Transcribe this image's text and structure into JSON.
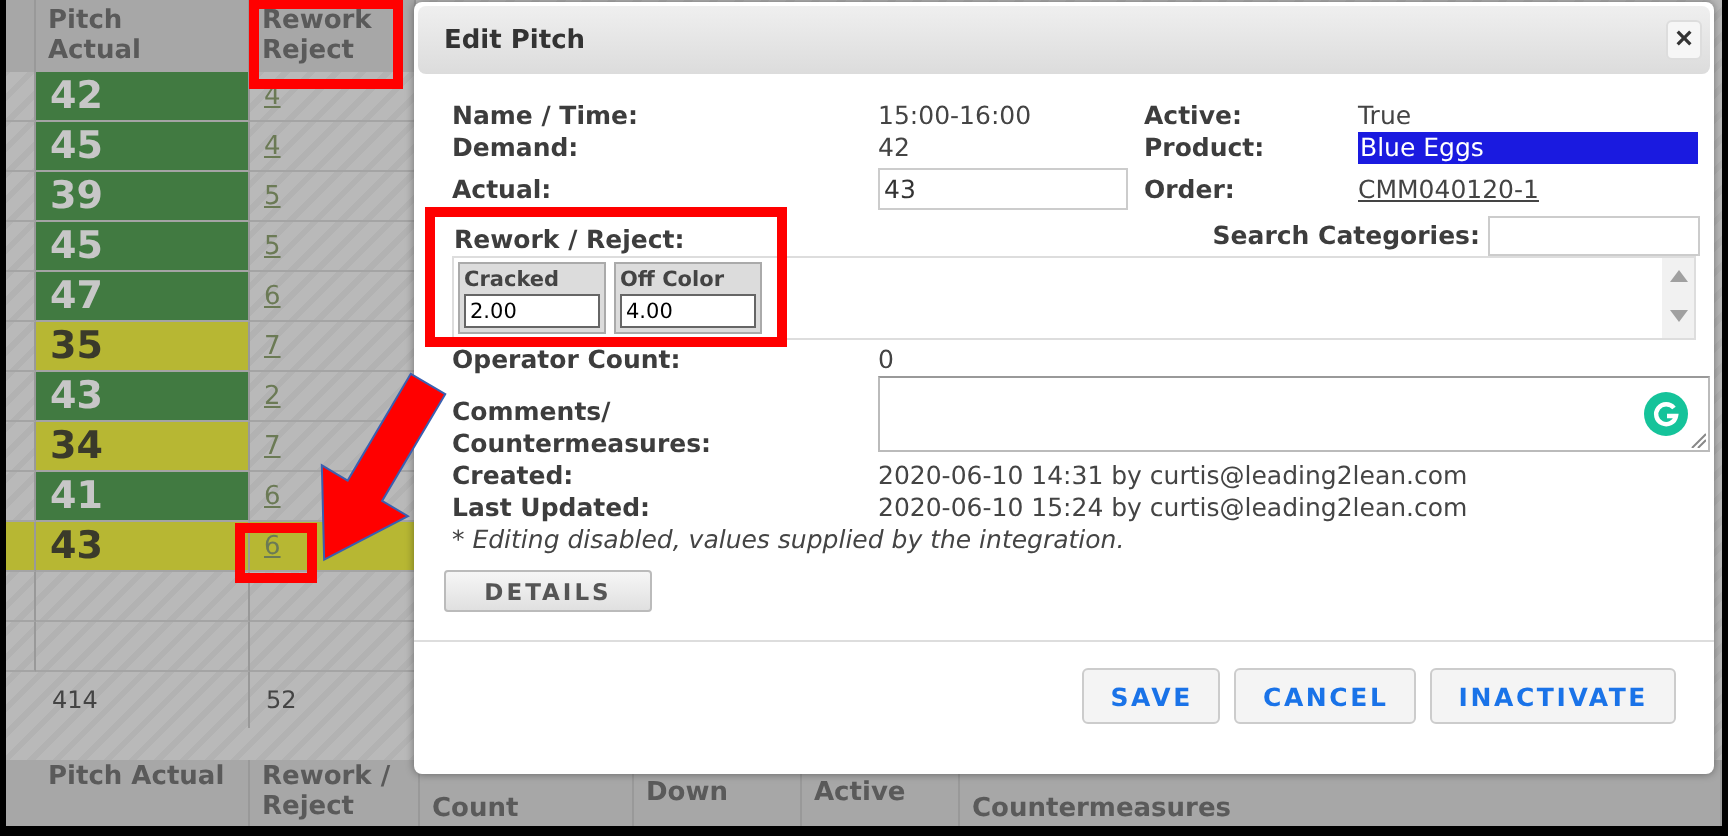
{
  "table": {
    "columns": [
      {
        "label": "Pitch Actual"
      },
      {
        "label": "Rework Reject"
      }
    ],
    "rows": [
      {
        "actual": "42",
        "rework": "4",
        "color": "#417a41",
        "selected": false
      },
      {
        "actual": "45",
        "rework": "4",
        "color": "#417a41",
        "selected": false
      },
      {
        "actual": "39",
        "rework": "5",
        "color": "#417a41",
        "selected": false
      },
      {
        "actual": "45",
        "rework": "5",
        "color": "#417a41",
        "selected": false
      },
      {
        "actual": "47",
        "rework": "6",
        "color": "#417a41",
        "selected": false
      },
      {
        "actual": "35",
        "rework": "7",
        "color": "#b7b733",
        "selected": false
      },
      {
        "actual": "43",
        "rework": "2",
        "color": "#417a41",
        "selected": false
      },
      {
        "actual": "34",
        "rework": "7",
        "color": "#b7b733",
        "selected": false
      },
      {
        "actual": "41",
        "rework": "6",
        "color": "#417a41",
        "selected": false
      },
      {
        "actual": "43",
        "rework": "6",
        "color": "#b7b733",
        "selected": true
      }
    ],
    "totals": [
      "414",
      "52"
    ]
  },
  "footer_header": [
    "Pitch Actual",
    "Rework / Reject",
    "Count",
    "Down",
    "Active",
    "Countermeasures"
  ],
  "dialog": {
    "title": "Edit Pitch",
    "close": "×",
    "fields": [
      {
        "left": {
          "label": "Name / Time:",
          "value": "15:00-16:00",
          "kind": "text"
        },
        "right": {
          "label": "Active:",
          "value": "True",
          "kind": "text"
        }
      },
      {
        "left": {
          "label": "Demand:",
          "value": "42",
          "kind": "text"
        },
        "right": {
          "label": "Product:",
          "value": "Blue Eggs",
          "kind": "highlight"
        }
      },
      {
        "left": {
          "label": "Actual:",
          "value": "43",
          "kind": "input"
        },
        "right": {
          "label": "Order:",
          "value": "CMM040120-1",
          "kind": "link"
        }
      }
    ],
    "search_label": "Search Categories:",
    "rework_label": "Rework / Reject:",
    "categories": [
      {
        "name": "Cracked",
        "value": "2.00"
      },
      {
        "name": "Off Color",
        "value": "4.00"
      }
    ],
    "operator_label": "Operator Count:",
    "operator_value": "0",
    "comments_label": "Comments/ Countermeasures:",
    "created_label": "Created:",
    "created": "2020-06-10 14:31 by curtis@leading2lean.com",
    "updated_label": "Last Updated:",
    "updated": "2020-06-10 15:24 by curtis@leading2lean.com",
    "note": "* Editing disabled, values supplied by the integration.",
    "details": "DETAILS",
    "buttons": [
      "SAVE",
      "CANCEL",
      "INACTIVATE"
    ]
  }
}
